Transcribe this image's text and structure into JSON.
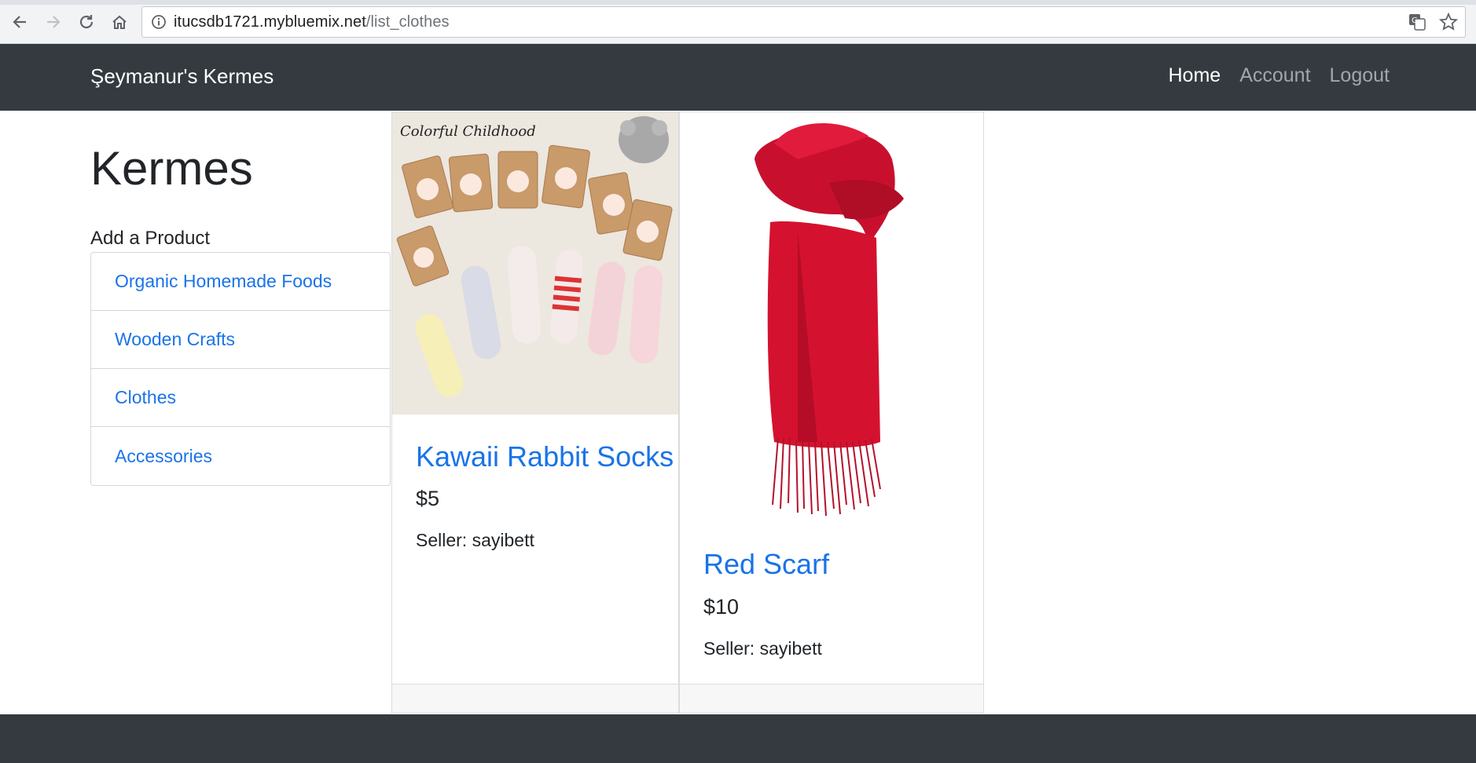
{
  "browser": {
    "url_host": "itucsdb1721.mybluemix.net",
    "url_path": "/list_clothes",
    "icons": [
      "back-icon",
      "forward-icon",
      "reload-icon",
      "home-icon",
      "info-icon",
      "translate-icon",
      "star-icon"
    ]
  },
  "navbar": {
    "brand": "Şeymanur's Kermes",
    "links": [
      {
        "label": "Home",
        "active": true
      },
      {
        "label": "Account",
        "active": false
      },
      {
        "label": "Logout",
        "active": false
      }
    ]
  },
  "sidebar": {
    "title": "Kermes",
    "add_label": "Add a Product",
    "categories": [
      {
        "label": "Organic Homemade Foods"
      },
      {
        "label": "Wooden Crafts"
      },
      {
        "label": "Clothes"
      },
      {
        "label": "Accessories"
      }
    ]
  },
  "products": [
    {
      "title": "Kawaii Rabbit Socks",
      "price": "$5",
      "seller": "Seller: sayibett",
      "image_caption": "Colorful Childhood"
    },
    {
      "title": "Red Scarf",
      "price": "$10",
      "seller": "Seller: sayibett"
    }
  ],
  "colors": {
    "navbar_bg": "#343a40",
    "link_blue": "#1a73e8",
    "scarf_red": "#d0102e"
  }
}
